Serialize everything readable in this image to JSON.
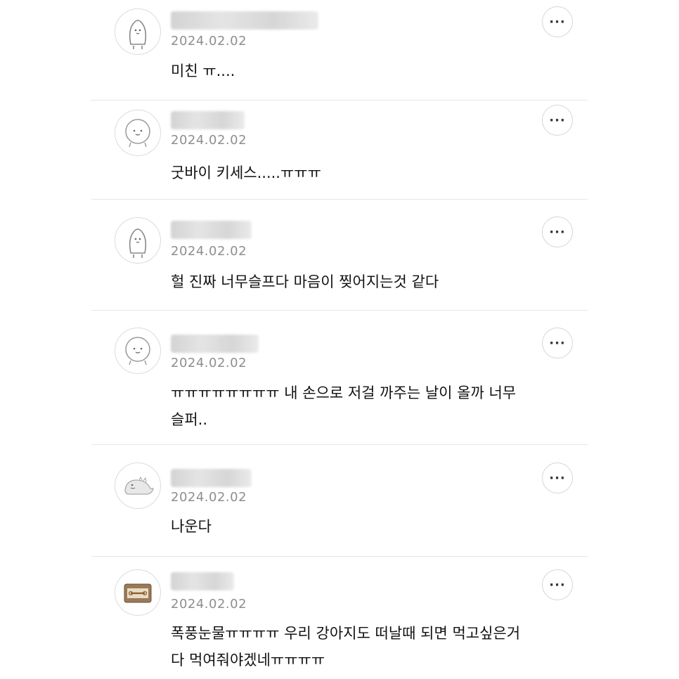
{
  "comments": [
    {
      "avatar": "penguin-avatar-icon",
      "date": "2024.02.02",
      "text": "미친 ㅠ....",
      "more_icon": "ellipsis-icon"
    },
    {
      "avatar": "round-face-avatar-icon",
      "date": "2024.02.02",
      "text": "굿바이 키세스.....ㅠㅠㅠ",
      "more_icon": "ellipsis-icon"
    },
    {
      "avatar": "penguin-avatar-icon",
      "date": "2024.02.02",
      "text": "헐 진짜 너무슬프다 마음이 찢어지는것 같다",
      "more_icon": "ellipsis-icon"
    },
    {
      "avatar": "round-face-avatar-icon",
      "date": "2024.02.02",
      "text_lines": [
        "ㅠㅠㅠㅠㅠㅠㅠㅠ 내 손으로 저걸 까주는 날이 올까 너무",
        "슬퍼.."
      ],
      "more_icon": "ellipsis-icon"
    },
    {
      "avatar": "dinosaur-avatar-icon",
      "date": "2024.02.02",
      "text": "나운다",
      "more_icon": "ellipsis-icon"
    },
    {
      "avatar": "handbag-avatar-icon",
      "date": "2024.02.02",
      "text_lines": [
        "폭풍눈물ㅠㅠㅠㅠ 우리 강아지도 떠날때 되면 먹고싶은거",
        "다 먹여줘야겠네ㅠㅠㅠㅠ"
      ],
      "more_icon": "ellipsis-icon"
    }
  ],
  "more_label": "···"
}
